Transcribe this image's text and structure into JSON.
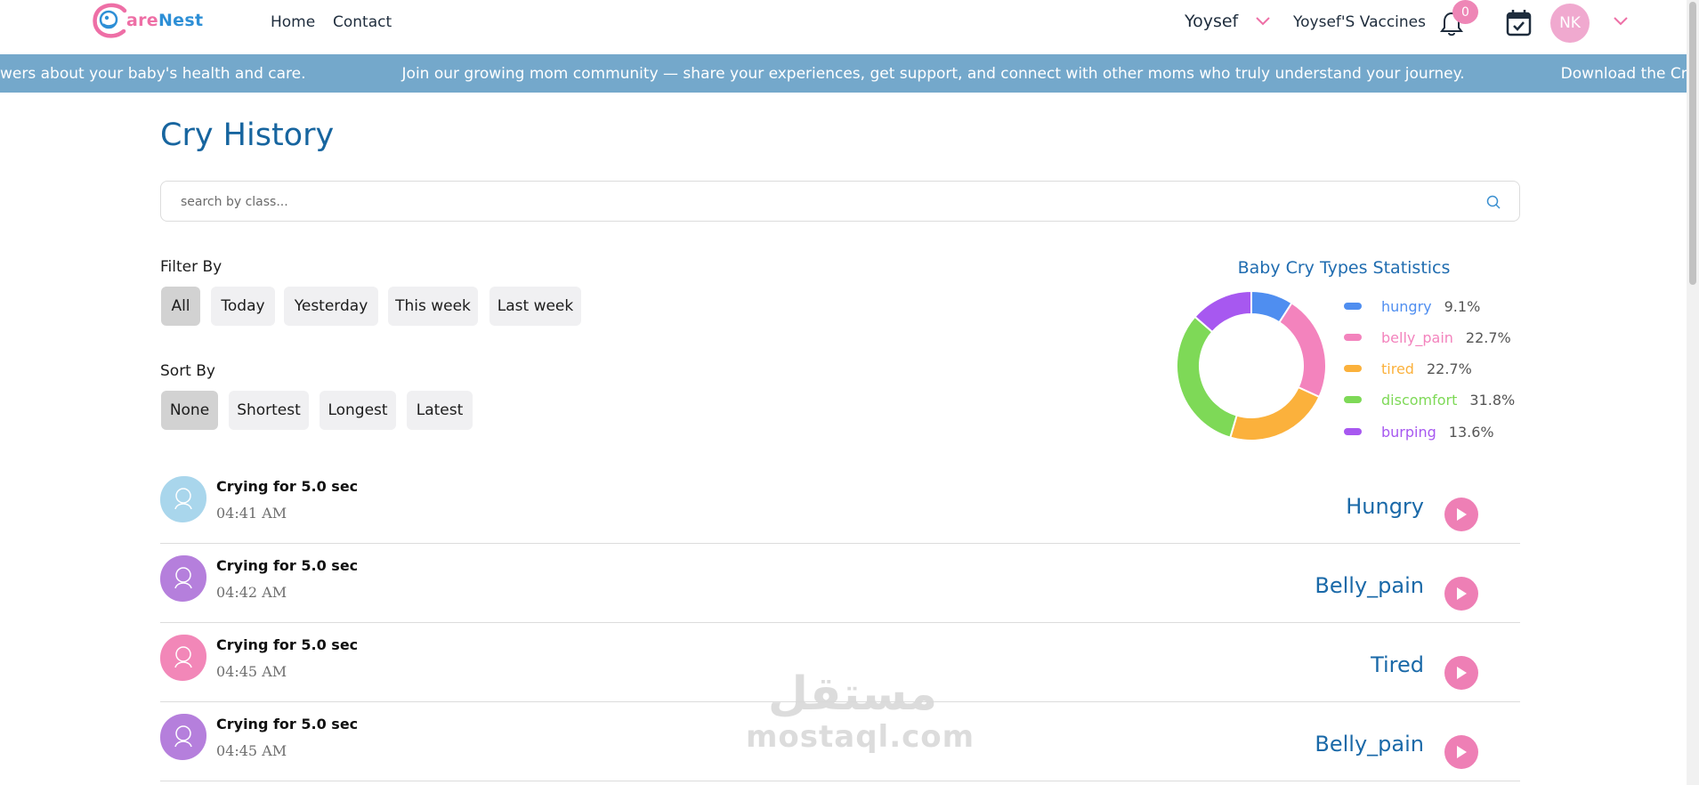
{
  "brand": {
    "logo_text_a": "are",
    "logo_text_b": "Nest"
  },
  "nav": {
    "home": "Home",
    "contact": "Contact"
  },
  "user": {
    "name": "Yoysef",
    "vaccines": "Yoysef'S Vaccines",
    "notification_count": "0",
    "initials": "NK"
  },
  "marquee": {
    "items": [
      "wers about your baby's health and care.",
      "Join our growing mom community — share your experiences, get support, and connect with other moms who truly understand your journey.",
      "Download the Cry Analyzer ap"
    ]
  },
  "page": {
    "title": "Cry History"
  },
  "search": {
    "placeholder": "search by class..."
  },
  "filter": {
    "label": "Filter By",
    "options": [
      "All",
      "Today",
      "Yesterday",
      "This week",
      "Last week"
    ],
    "selected": "All"
  },
  "sort": {
    "label": "Sort By",
    "options": [
      "None",
      "Shortest",
      "Longest",
      "Latest"
    ],
    "selected": "None"
  },
  "stats": {
    "title": "Baby Cry Types Statistics",
    "items": [
      {
        "label": "hungry",
        "pct": "9.1%",
        "color": "#4f8ef0"
      },
      {
        "label": "belly_pain",
        "pct": "22.7%",
        "color": "#f383bd"
      },
      {
        "label": "tired",
        "pct": "22.7%",
        "color": "#fbb13c"
      },
      {
        "label": "discomfort",
        "pct": "31.8%",
        "color": "#7ed957"
      },
      {
        "label": "burping",
        "pct": "13.6%",
        "color": "#a758f0"
      }
    ]
  },
  "chart_data": {
    "type": "pie",
    "title": "Baby Cry Types Statistics",
    "categories": [
      "hungry",
      "belly_pain",
      "tired",
      "discomfort",
      "burping"
    ],
    "values": [
      9.1,
      22.7,
      22.7,
      31.8,
      13.6
    ],
    "colors": [
      "#4f8ef0",
      "#f383bd",
      "#fbb13c",
      "#7ed957",
      "#a758f0"
    ],
    "legend": "right"
  },
  "cries": [
    {
      "duration": "Crying for 5.0 sec",
      "time": "04:41 AM",
      "class": "Hungry",
      "avatar_color": "#a9d6ec"
    },
    {
      "duration": "Crying for 5.0 sec",
      "time": "04:42 AM",
      "class": "Belly_pain",
      "avatar_color": "#b57fdc"
    },
    {
      "duration": "Crying for 5.0 sec",
      "time": "04:45 AM",
      "class": "Tired",
      "avatar_color": "#f287b8"
    },
    {
      "duration": "Crying for 5.0 sec",
      "time": "04:45 AM",
      "class": "Belly_pain",
      "avatar_color": "#b57fdc"
    }
  ],
  "watermark": {
    "arabic": "مستقل",
    "latin": "mostaql.com"
  }
}
